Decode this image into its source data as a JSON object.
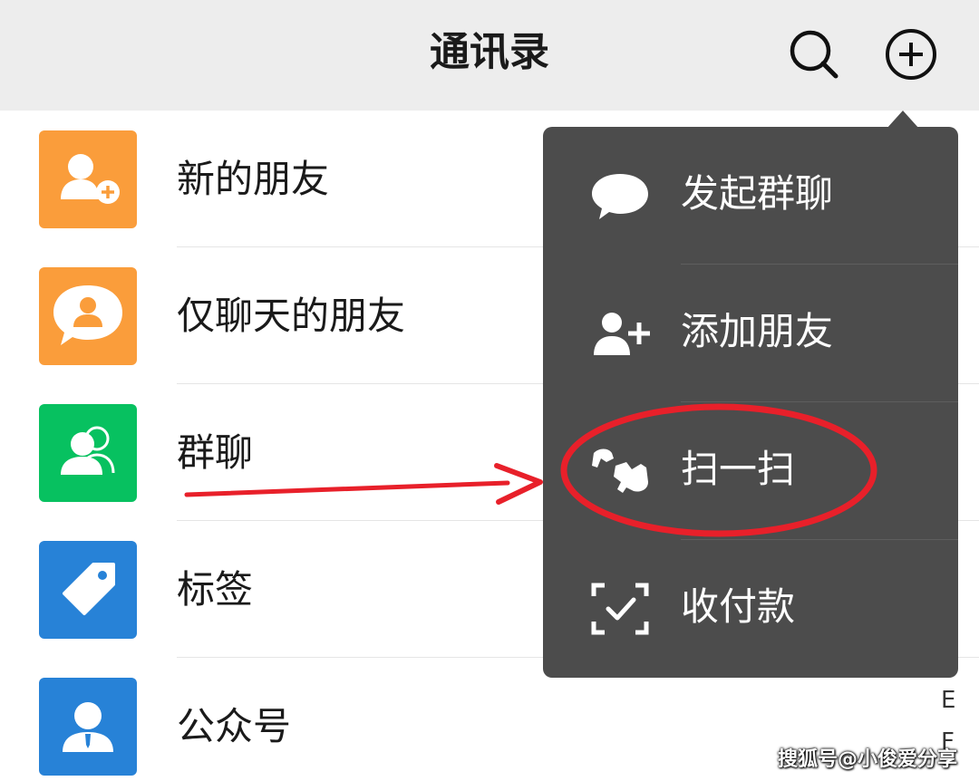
{
  "header": {
    "title": "通讯录",
    "search_icon": "search-icon",
    "add_icon": "plus-circle-icon"
  },
  "list": {
    "items": [
      {
        "label": "新的朋友",
        "icon": "add-friend-icon",
        "color": "#fa9d3b"
      },
      {
        "label": "仅聊天的朋友",
        "icon": "chat-only-friend-icon",
        "color": "#fa9d3b"
      },
      {
        "label": "群聊",
        "icon": "group-chat-icon",
        "color": "#07c160"
      },
      {
        "label": "标签",
        "icon": "tag-icon",
        "color": "#2782d7"
      },
      {
        "label": "公众号",
        "icon": "official-account-icon",
        "color": "#2782d7"
      }
    ]
  },
  "index_letters": [
    "E",
    "F"
  ],
  "popup_menu": {
    "items": [
      {
        "label": "发起群聊",
        "icon": "chat-bubble-icon"
      },
      {
        "label": "添加朋友",
        "icon": "add-person-icon"
      },
      {
        "label": "扫一扫",
        "icon": "scan-icon"
      },
      {
        "label": "收付款",
        "icon": "payment-scan-icon"
      }
    ],
    "highlight_color": "#e8202a"
  },
  "watermark": "搜狐号@小俊爱分享"
}
